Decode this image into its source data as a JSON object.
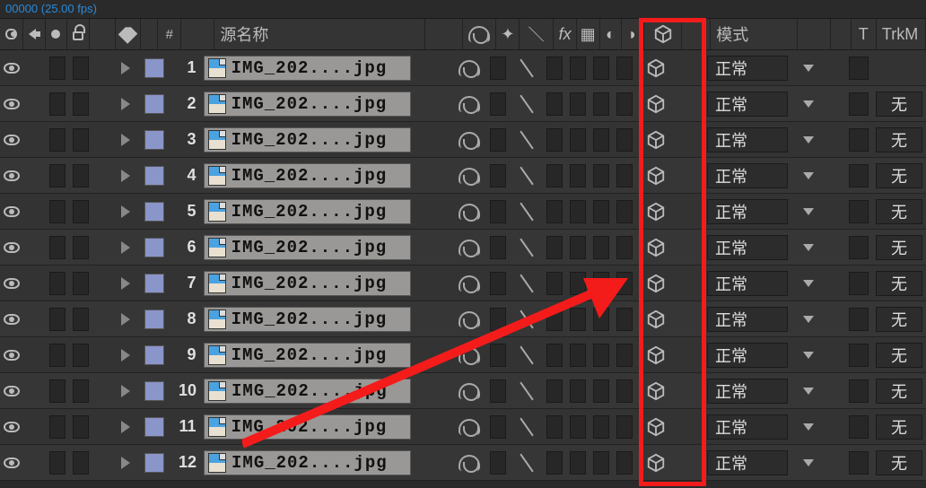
{
  "timecode": "00000 (25.00 fps)",
  "header": {
    "source_name": "源名称",
    "mode": "模式",
    "t": "T",
    "trkm": "TrkM"
  },
  "mode_label": "正常",
  "trk_label": "无",
  "layers": [
    {
      "index": "1",
      "name": "IMG_202....jpg"
    },
    {
      "index": "2",
      "name": "IMG_202....jpg"
    },
    {
      "index": "3",
      "name": "IMG_202....jpg"
    },
    {
      "index": "4",
      "name": "IMG_202....jpg"
    },
    {
      "index": "5",
      "name": "IMG_202....jpg"
    },
    {
      "index": "6",
      "name": "IMG_202....jpg"
    },
    {
      "index": "7",
      "name": "IMG_202....jpg"
    },
    {
      "index": "8",
      "name": "IMG_202....jpg"
    },
    {
      "index": "9",
      "name": "IMG_202....jpg"
    },
    {
      "index": "10",
      "name": "IMG_202....jpg"
    },
    {
      "index": "11",
      "name": "IMG_202....jpg"
    },
    {
      "index": "12",
      "name": "IMG_202....jpg"
    }
  ]
}
